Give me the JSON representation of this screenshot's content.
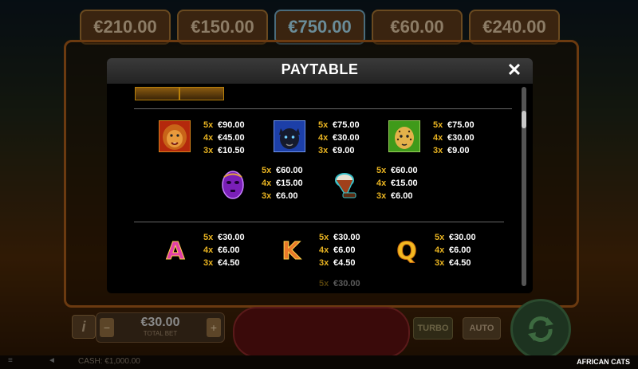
{
  "jackpots": [
    "€210.00",
    "€150.00",
    "€750.00",
    "€60.00",
    "€240.00"
  ],
  "modal": {
    "title": "PAYTABLE",
    "close_glyph": "✕"
  },
  "high_symbols": [
    {
      "symbol": "lion-icon",
      "pays": [
        [
          "5x",
          "€90.00"
        ],
        [
          "4x",
          "€45.00"
        ],
        [
          "3x",
          "€10.50"
        ]
      ]
    },
    {
      "symbol": "panther-icon",
      "pays": [
        [
          "5x",
          "€75.00"
        ],
        [
          "4x",
          "€30.00"
        ],
        [
          "3x",
          "€9.00"
        ]
      ]
    },
    {
      "symbol": "cheetah-icon",
      "pays": [
        [
          "5x",
          "€75.00"
        ],
        [
          "4x",
          "€30.00"
        ],
        [
          "3x",
          "€9.00"
        ]
      ]
    }
  ],
  "mid_symbols": [
    {
      "symbol": "mask-icon",
      "pays": [
        [
          "5x",
          "€60.00"
        ],
        [
          "4x",
          "€15.00"
        ],
        [
          "3x",
          "€6.00"
        ]
      ]
    },
    {
      "symbol": "drum-icon",
      "pays": [
        [
          "5x",
          "€60.00"
        ],
        [
          "4x",
          "€15.00"
        ],
        [
          "3x",
          "€6.00"
        ]
      ]
    }
  ],
  "letter_symbols": [
    {
      "letter": "A",
      "color": "#e23fa8",
      "pays": [
        [
          "5x",
          "€30.00"
        ],
        [
          "4x",
          "€6.00"
        ],
        [
          "3x",
          "€4.50"
        ]
      ]
    },
    {
      "letter": "K",
      "color": "#e8792a",
      "pays": [
        [
          "5x",
          "€30.00"
        ],
        [
          "4x",
          "€6.00"
        ],
        [
          "3x",
          "€4.50"
        ]
      ]
    },
    {
      "letter": "Q",
      "color": "#f2b820",
      "pays": [
        [
          "5x",
          "€30.00"
        ],
        [
          "4x",
          "€6.00"
        ],
        [
          "3x",
          "€4.50"
        ]
      ]
    }
  ],
  "partial_row": {
    "mult": "5x",
    "amount": "€30.00"
  },
  "bet": {
    "value": "€30.00",
    "label": "TOTAL BET",
    "minus": "−",
    "plus": "+"
  },
  "info_label": "i",
  "turbo_label": "TURBO",
  "auto_label": "AUTO",
  "footer": {
    "cash": "CASH: €1,000.00",
    "game_name": "AFRICAN CATS"
  },
  "colors": {
    "accent_multiplier": "#e8b321",
    "modal_bg": "#000000"
  }
}
